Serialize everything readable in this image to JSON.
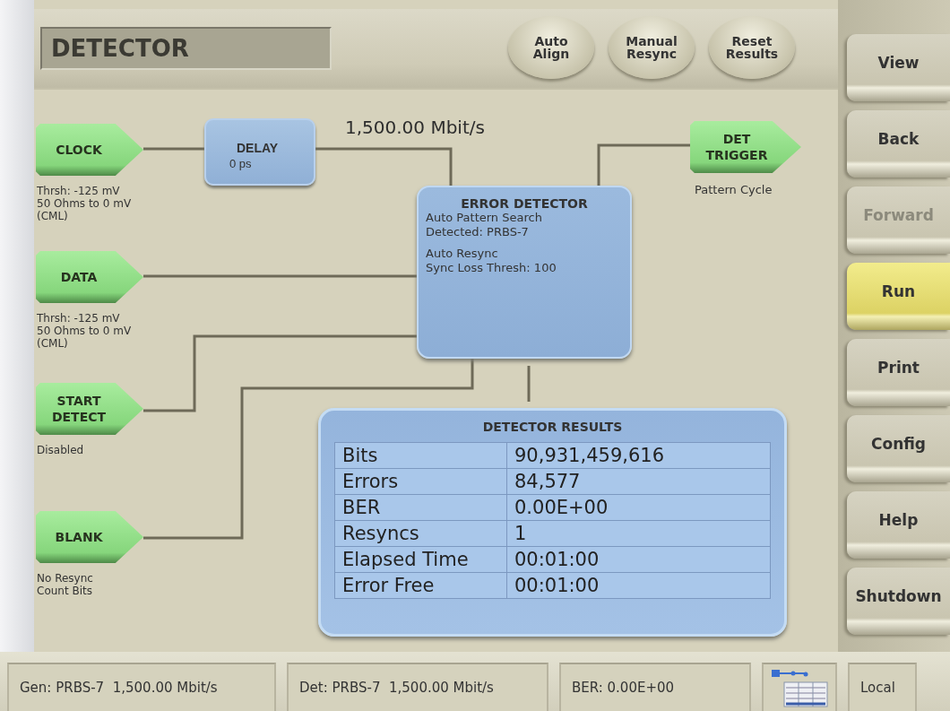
{
  "header": {
    "title": "DETECTOR",
    "buttons": [
      "Auto\nAlign",
      "Manual\nResync",
      "Reset\nResults"
    ]
  },
  "diagram": {
    "rate": "1,500.00 Mbit/s",
    "inputs": [
      {
        "label": "CLOCK",
        "caption": "Thrsh: -125 mV\n50 Ohms to 0 mV\n(CML)"
      },
      {
        "label": "DATA",
        "caption": "Thrsh: -125 mV\n50 Ohms to 0 mV\n(CML)"
      },
      {
        "label": "START\nDETECT",
        "caption": "Disabled"
      },
      {
        "label": "BLANK",
        "caption": "No Resync\nCount Bits"
      }
    ],
    "delay": {
      "title": "DELAY",
      "value": "0 ps"
    },
    "trigger": {
      "label": "DET\nTRIGGER",
      "caption": "Pattern Cycle"
    },
    "error_detector": {
      "title": "ERROR DETECTOR",
      "groups": [
        "Auto Pattern Search\nDetected: PRBS-7",
        "Auto Resync\nSync Loss Thresh: 100"
      ]
    },
    "results": {
      "title": "DETECTOR RESULTS",
      "rows": [
        {
          "label": "Bits",
          "value": "90,931,459,616"
        },
        {
          "label": "Errors",
          "value": "84,577"
        },
        {
          "label": "BER",
          "value": "0.00E+00"
        },
        {
          "label": "Resyncs",
          "value": "1"
        },
        {
          "label": "Elapsed Time",
          "value": "00:01:00"
        },
        {
          "label": "Error Free",
          "value": "00:01:00"
        }
      ]
    }
  },
  "nav": [
    {
      "label": "View",
      "disabled": false,
      "active": false
    },
    {
      "label": "Back",
      "disabled": false,
      "active": false
    },
    {
      "label": "Forward",
      "disabled": true,
      "active": false
    },
    {
      "label": "Run",
      "disabled": false,
      "active": true
    },
    {
      "label": "Print",
      "disabled": false,
      "active": false
    },
    {
      "label": "Config",
      "disabled": false,
      "active": false
    },
    {
      "label": "Help",
      "disabled": false,
      "active": false
    },
    {
      "label": "Shutdown",
      "disabled": false,
      "active": false
    }
  ],
  "status_bar": [
    {
      "kind": "text",
      "text": "Gen: PRBS-7  1,500.00 Mbit/s"
    },
    {
      "kind": "text",
      "text": "Det: PRBS-7  1,500.00 Mbit/s"
    },
    {
      "kind": "text",
      "text": "BER: 0.00E+00"
    },
    {
      "kind": "icon"
    },
    {
      "kind": "text",
      "text": "Local"
    }
  ]
}
